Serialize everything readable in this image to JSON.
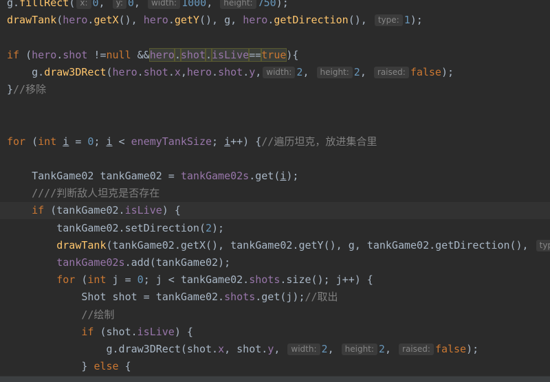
{
  "editor": {
    "lines": [
      {
        "indent": "",
        "tokens": [
          {
            "t": "g.",
            "c": "plain"
          },
          {
            "t": "fillRect",
            "c": "fn"
          },
          {
            "t": "(",
            "c": "plain"
          },
          {
            "hint": "x:"
          },
          {
            "t": "0",
            "c": "num"
          },
          {
            "t": ", ",
            "c": "plain"
          },
          {
            "hint": "y:"
          },
          {
            "t": "0",
            "c": "num"
          },
          {
            "t": ", ",
            "c": "plain"
          },
          {
            "hint": "width:"
          },
          {
            "t": "1000",
            "c": "num"
          },
          {
            "t": ", ",
            "c": "plain"
          },
          {
            "hint": "height:"
          },
          {
            "t": "750",
            "c": "num"
          },
          {
            "t": ");",
            "c": "plain"
          }
        ]
      },
      {
        "indent": "",
        "tokens": [
          {
            "t": "drawTank",
            "c": "fn"
          },
          {
            "t": "(",
            "c": "plain"
          },
          {
            "t": "hero",
            "c": "field"
          },
          {
            "t": ".",
            "c": "plain"
          },
          {
            "t": "getX",
            "c": "fn"
          },
          {
            "t": "(), ",
            "c": "plain"
          },
          {
            "t": "hero",
            "c": "field"
          },
          {
            "t": ".",
            "c": "plain"
          },
          {
            "t": "getY",
            "c": "fn"
          },
          {
            "t": "(), g, ",
            "c": "plain"
          },
          {
            "t": "hero",
            "c": "field"
          },
          {
            "t": ".",
            "c": "plain"
          },
          {
            "t": "getDirection",
            "c": "fn"
          },
          {
            "t": "(), ",
            "c": "plain"
          },
          {
            "hint": "type:"
          },
          {
            "t": "1",
            "c": "num"
          },
          {
            "t": ");",
            "c": "plain"
          }
        ]
      },
      {
        "indent": "",
        "tokens": []
      },
      {
        "indent": "",
        "tokens": [
          {
            "t": "if",
            "c": "kw"
          },
          {
            "t": " (",
            "c": "plain"
          },
          {
            "t": "hero",
            "c": "field"
          },
          {
            "t": ".",
            "c": "plain"
          },
          {
            "t": "shot",
            "c": "field"
          },
          {
            "t": " !=",
            "c": "plain"
          },
          {
            "t": "null",
            "c": "kw"
          },
          {
            "t": " &&",
            "c": "plain"
          },
          {
            "t": "hero",
            "c": "field",
            "hl": true
          },
          {
            "t": ".",
            "c": "plain",
            "hl": true
          },
          {
            "t": "shot",
            "c": "field",
            "hl": true
          },
          {
            "t": ".",
            "c": "plain",
            "hl": true
          },
          {
            "t": "isLive",
            "c": "field",
            "hl": true
          },
          {
            "t": "==",
            "c": "plain",
            "hl": true
          },
          {
            "t": "true",
            "c": "kw",
            "hl": true
          },
          {
            "t": "){",
            "c": "plain"
          }
        ]
      },
      {
        "indent": "    ",
        "tokens": [
          {
            "t": "g.",
            "c": "plain"
          },
          {
            "t": "draw3DRect",
            "c": "fn"
          },
          {
            "t": "(",
            "c": "plain"
          },
          {
            "t": "hero",
            "c": "field"
          },
          {
            "t": ".",
            "c": "plain"
          },
          {
            "t": "shot",
            "c": "field"
          },
          {
            "t": ".",
            "c": "plain"
          },
          {
            "t": "x",
            "c": "field"
          },
          {
            "t": ",",
            "c": "plain"
          },
          {
            "t": "hero",
            "c": "field"
          },
          {
            "t": ".",
            "c": "plain"
          },
          {
            "t": "shot",
            "c": "field"
          },
          {
            "t": ".",
            "c": "plain"
          },
          {
            "t": "y",
            "c": "field"
          },
          {
            "t": ",",
            "c": "plain"
          },
          {
            "hint": "width:"
          },
          {
            "t": "2",
            "c": "num"
          },
          {
            "t": ", ",
            "c": "plain"
          },
          {
            "hint": "height:"
          },
          {
            "t": "2",
            "c": "num"
          },
          {
            "t": ", ",
            "c": "plain"
          },
          {
            "hint": "raised:"
          },
          {
            "t": "false",
            "c": "kw"
          },
          {
            "t": ");",
            "c": "plain"
          }
        ]
      },
      {
        "indent": "",
        "tokens": [
          {
            "t": "}",
            "c": "plain"
          },
          {
            "t": "//移除",
            "c": "cm"
          }
        ]
      },
      {
        "indent": "",
        "tokens": []
      },
      {
        "indent": "",
        "tokens": []
      },
      {
        "indent": "",
        "tokens": [
          {
            "t": "for",
            "c": "kw"
          },
          {
            "t": " (",
            "c": "plain"
          },
          {
            "t": "int",
            "c": "kw"
          },
          {
            "t": " ",
            "c": "plain"
          },
          {
            "t": "i",
            "c": "var"
          },
          {
            "t": " = ",
            "c": "plain"
          },
          {
            "t": "0",
            "c": "num"
          },
          {
            "t": "; ",
            "c": "plain"
          },
          {
            "t": "i",
            "c": "var"
          },
          {
            "t": " < ",
            "c": "plain"
          },
          {
            "t": "enemyTankSize",
            "c": "field"
          },
          {
            "t": "; ",
            "c": "plain"
          },
          {
            "t": "i",
            "c": "var"
          },
          {
            "t": "++) {",
            "c": "plain"
          },
          {
            "t": "//遍历坦克，放进集合里",
            "c": "cm"
          }
        ]
      },
      {
        "indent": "",
        "tokens": []
      },
      {
        "indent": "    ",
        "tokens": [
          {
            "t": "TankGame02 tankGame02 = ",
            "c": "plain"
          },
          {
            "t": "tankGame02s",
            "c": "field"
          },
          {
            "t": ".get(",
            "c": "plain"
          },
          {
            "t": "i",
            "c": "var"
          },
          {
            "t": ");",
            "c": "plain"
          }
        ]
      },
      {
        "indent": "    ",
        "tokens": [
          {
            "t": "////判断敌人坦克是否存在",
            "c": "cm"
          }
        ]
      },
      {
        "indent": "    ",
        "current": true,
        "tokens": [
          {
            "t": "if",
            "c": "kw"
          },
          {
            "t": " (tankGame02.",
            "c": "plain"
          },
          {
            "t": "isLive",
            "c": "field"
          },
          {
            "t": ") {",
            "c": "plain"
          }
        ]
      },
      {
        "indent": "        ",
        "tokens": [
          {
            "t": "tankGame02.setDirection(",
            "c": "plain"
          },
          {
            "t": "2",
            "c": "num"
          },
          {
            "t": ");",
            "c": "plain"
          }
        ]
      },
      {
        "indent": "        ",
        "tokens": [
          {
            "t": "drawTank",
            "c": "fn"
          },
          {
            "t": "(tankGame02.getX(), tankGame02.getY(), g, tankGame02.getDirection(), ",
            "c": "plain"
          },
          {
            "hint": "type:"
          }
        ]
      },
      {
        "indent": "        ",
        "tokens": [
          {
            "t": "tankGame02s",
            "c": "field"
          },
          {
            "t": ".add(tankGame02);",
            "c": "plain"
          }
        ]
      },
      {
        "indent": "        ",
        "tokens": [
          {
            "t": "for",
            "c": "kw"
          },
          {
            "t": " (",
            "c": "plain"
          },
          {
            "t": "int",
            "c": "kw"
          },
          {
            "t": " j = ",
            "c": "plain"
          },
          {
            "t": "0",
            "c": "num"
          },
          {
            "t": "; j < tankGame02.",
            "c": "plain"
          },
          {
            "t": "shots",
            "c": "field"
          },
          {
            "t": ".size(); j++) {",
            "c": "plain"
          }
        ]
      },
      {
        "indent": "            ",
        "tokens": [
          {
            "t": "Shot shot = tankGame02.",
            "c": "plain"
          },
          {
            "t": "shots",
            "c": "field"
          },
          {
            "t": ".get(j);",
            "c": "plain"
          },
          {
            "t": "//取出",
            "c": "cm"
          }
        ]
      },
      {
        "indent": "            ",
        "tokens": [
          {
            "t": "//绘制",
            "c": "cm"
          }
        ]
      },
      {
        "indent": "            ",
        "tokens": [
          {
            "t": "if",
            "c": "kw"
          },
          {
            "t": " (shot.",
            "c": "plain"
          },
          {
            "t": "isLive",
            "c": "field"
          },
          {
            "t": ") {",
            "c": "plain"
          }
        ]
      },
      {
        "indent": "                ",
        "tokens": [
          {
            "t": "g.draw3DRect(shot.",
            "c": "plain"
          },
          {
            "t": "x",
            "c": "field"
          },
          {
            "t": ", shot.",
            "c": "plain"
          },
          {
            "t": "y",
            "c": "field"
          },
          {
            "t": ", ",
            "c": "plain"
          },
          {
            "hint": "width:"
          },
          {
            "t": "2",
            "c": "num"
          },
          {
            "t": ", ",
            "c": "plain"
          },
          {
            "hint": "height:"
          },
          {
            "t": "2",
            "c": "num"
          },
          {
            "t": ", ",
            "c": "plain"
          },
          {
            "hint": "raised:"
          },
          {
            "t": "false",
            "c": "kw"
          },
          {
            "t": ");",
            "c": "plain"
          }
        ]
      },
      {
        "indent": "            ",
        "tokens": [
          {
            "t": "} ",
            "c": "plain"
          },
          {
            "t": "else",
            "c": "kw"
          },
          {
            "t": " {",
            "c": "plain"
          }
        ]
      }
    ]
  }
}
